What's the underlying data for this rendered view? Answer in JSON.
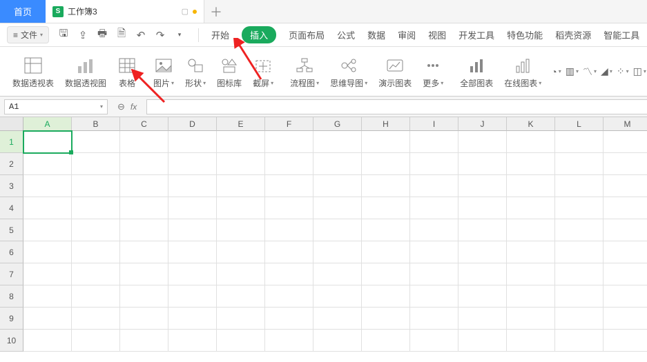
{
  "tabs": {
    "home": "首页",
    "doc_icon": "S",
    "doc_title": "工作簿3"
  },
  "toolbar": {
    "file": "文件"
  },
  "ribbon_tabs": {
    "start": "开始",
    "insert": "插入",
    "page_layout": "页面布局",
    "formulas": "公式",
    "data": "数据",
    "review": "审阅",
    "view": "视图",
    "dev": "开发工具",
    "special": "特色功能",
    "resource": "稻壳资源",
    "smart": "智能工具"
  },
  "ribbon_groups": {
    "pivot_table": "数据透视表",
    "pivot_chart": "数据透视图",
    "table": "表格",
    "picture": "图片",
    "shapes": "形状",
    "icon_lib": "图标库",
    "screenshot": "截屏",
    "flowchart": "流程图",
    "mindmap": "思维导图",
    "demo_chart": "演示图表",
    "more": "更多",
    "all_charts": "全部图表",
    "online_chart": "在线图表"
  },
  "formula_bar": {
    "cell_ref": "A1",
    "fx": "fx"
  },
  "columns": [
    "A",
    "B",
    "C",
    "D",
    "E",
    "F",
    "G",
    "H",
    "I",
    "J",
    "K",
    "L",
    "M"
  ],
  "rows": [
    "1",
    "2",
    "3",
    "4",
    "5",
    "6",
    "7",
    "8",
    "9",
    "10"
  ],
  "active_cell": "A1"
}
